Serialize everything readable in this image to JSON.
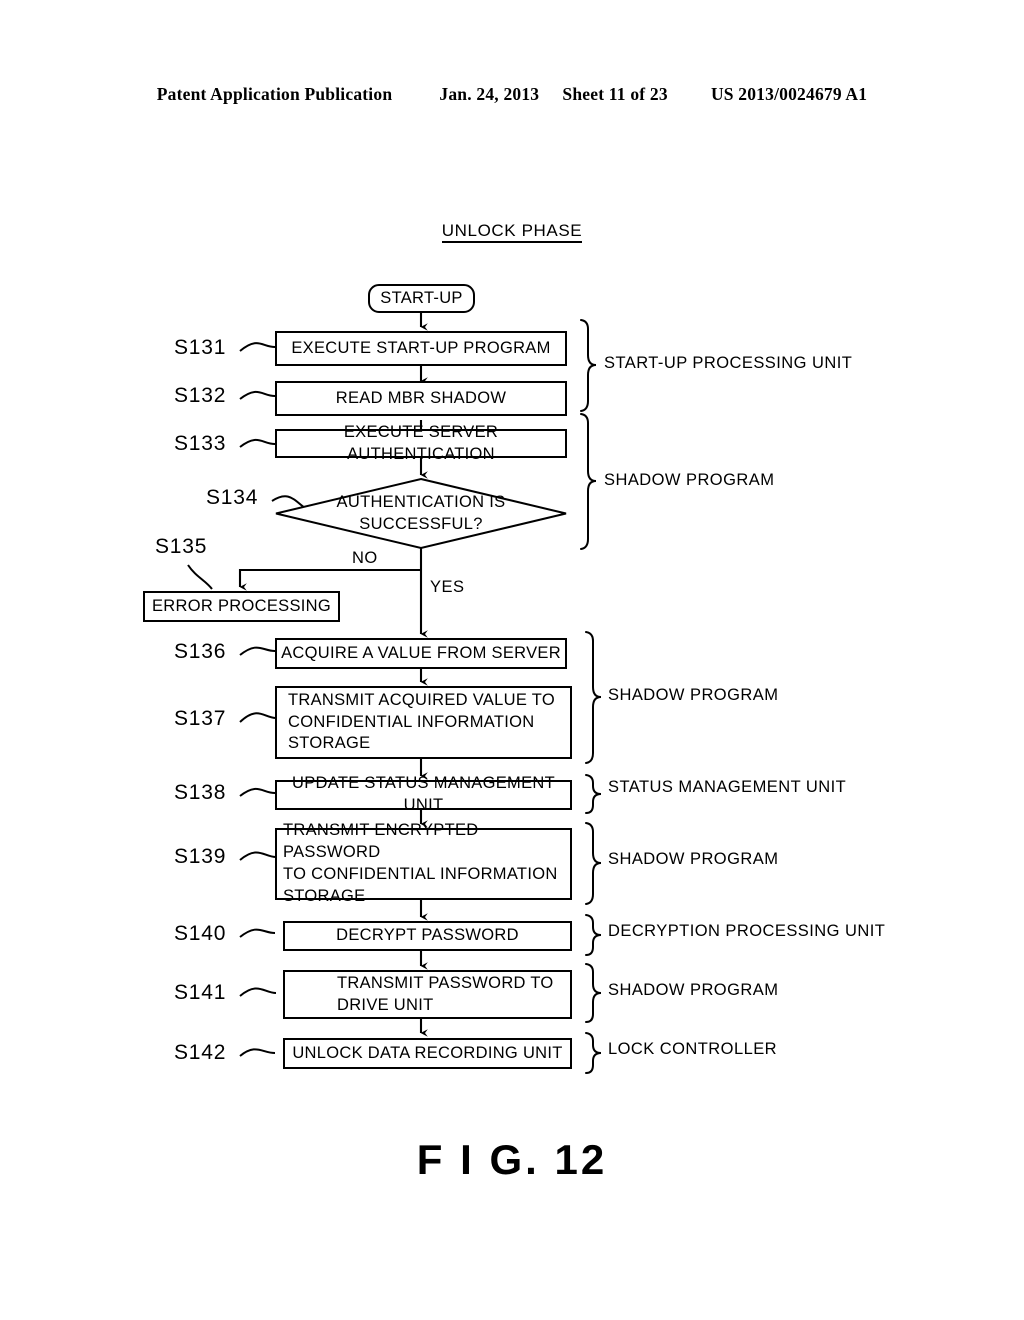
{
  "header": {
    "publication": "Patent Application Publication",
    "date": "Jan. 24, 2013",
    "sheet": "Sheet 11 of 23",
    "patent_number": "US 2013/0024679 A1"
  },
  "figure": {
    "title": "UNLOCK PHASE",
    "caption": "F I G. 12"
  },
  "nodes": {
    "start": "START-UP",
    "s131": "EXECUTE START-UP PROGRAM",
    "s132": "READ MBR SHADOW",
    "s133": "EXECUTE SERVER AUTHENTICATION",
    "s134_line1": "AUTHENTICATION IS",
    "s134_line2": "SUCCESSFUL?",
    "s135": "ERROR PROCESSING",
    "s136": "ACQUIRE A VALUE FROM SERVER",
    "s137_line1": "TRANSMIT ACQUIRED VALUE TO",
    "s137_line2": "CONFIDENTIAL INFORMATION",
    "s137_line3": "STORAGE",
    "s138": "UPDATE STATUS MANAGEMENT UNIT",
    "s139_line1": "TRANSMIT ENCRYPTED PASSWORD",
    "s139_line2": "TO CONFIDENTIAL INFORMATION",
    "s139_line3": "STORAGE",
    "s140": "DECRYPT PASSWORD",
    "s141_line1": "TRANSMIT PASSWORD TO",
    "s141_line2": "DRIVE UNIT",
    "s142": "UNLOCK DATA RECORDING UNIT"
  },
  "step_labels": {
    "s131": "S131",
    "s132": "S132",
    "s133": "S133",
    "s134": "S134",
    "s135": "S135",
    "s136": "S136",
    "s137": "S137",
    "s138": "S138",
    "s139": "S139",
    "s140": "S140",
    "s141": "S141",
    "s142": "S142"
  },
  "branch_labels": {
    "no": "NO",
    "yes": "YES"
  },
  "group_labels": {
    "startup_processing_unit": "START-UP PROCESSING UNIT",
    "shadow_program_1": "SHADOW PROGRAM",
    "shadow_program_2": "SHADOW PROGRAM",
    "status_management_unit": "STATUS MANAGEMENT UNIT",
    "shadow_program_3": "SHADOW PROGRAM",
    "decryption_processing_unit": "DECRYPTION PROCESSING UNIT",
    "shadow_program_4": "SHADOW PROGRAM",
    "lock_controller": "LOCK CONTROLLER"
  },
  "colors": {
    "ink": "#000000",
    "paper": "#ffffff"
  }
}
